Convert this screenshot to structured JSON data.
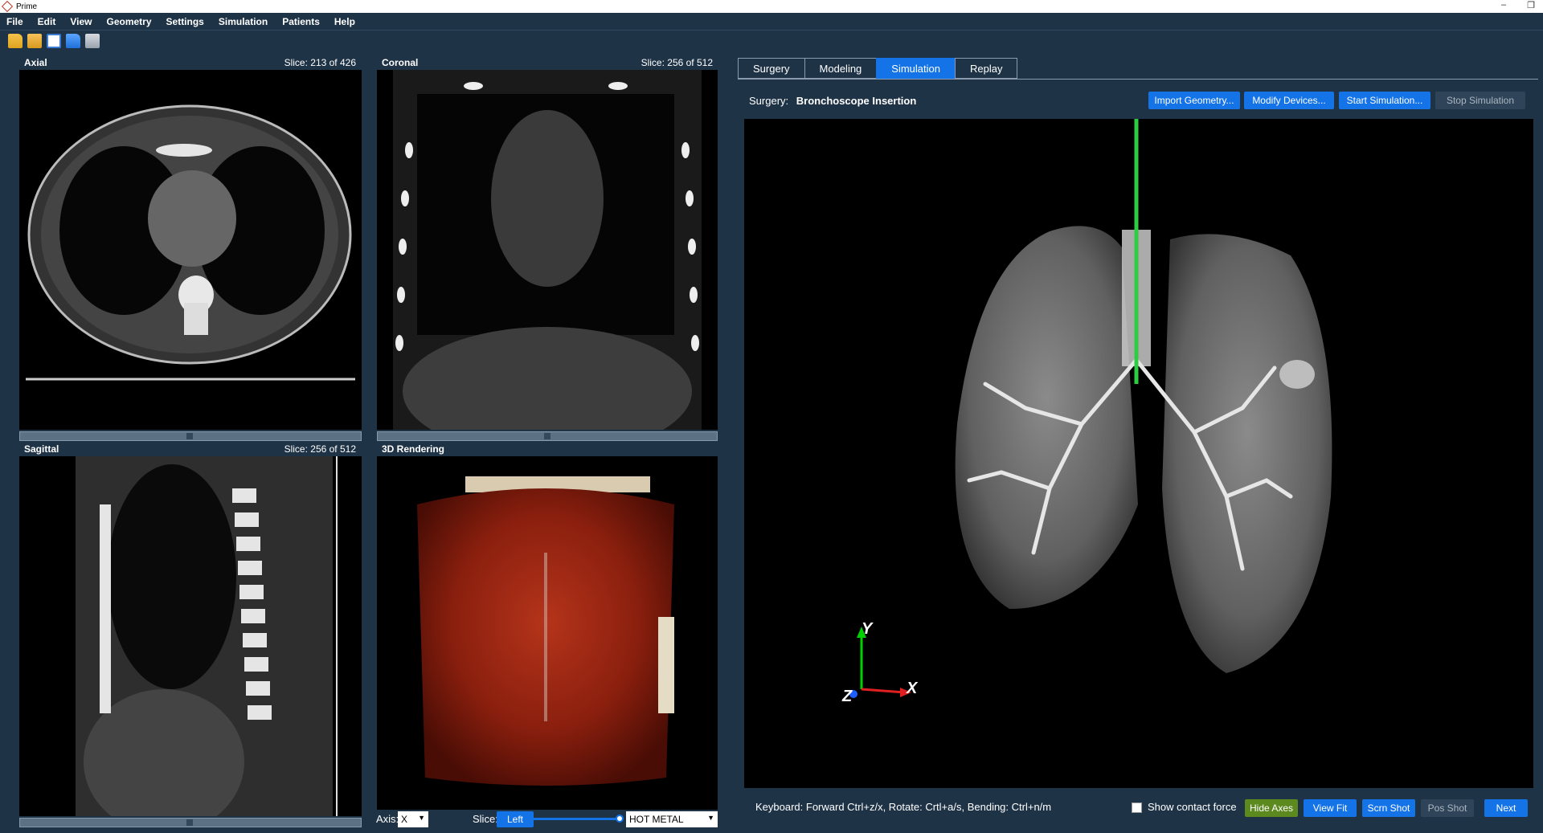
{
  "window": {
    "title": "Prime",
    "minimize": "–",
    "maximize": "❐"
  },
  "menu": [
    "File",
    "Edit",
    "View",
    "Geometry",
    "Settings",
    "Simulation",
    "Patients",
    "Help"
  ],
  "toolbar": {
    "icons": [
      "open-folder-icon",
      "open-file-icon",
      "document-icon",
      "blue-folder-icon",
      "screenshot-icon"
    ]
  },
  "panels": {
    "axial": {
      "title": "Axial",
      "slice": "Slice: 213 of 426"
    },
    "coronal": {
      "title": "Coronal",
      "slice": "Slice: 256 of 512"
    },
    "sagittal": {
      "title": "Sagittal",
      "slice": "Slice: 256 of 512"
    },
    "rendering": {
      "title": "3D Rendering"
    }
  },
  "render_controls": {
    "axis_label": "Axis:",
    "axis_value": "X",
    "slice_label": "Slice:",
    "slice_button": "Left",
    "colormap": "HOT METAL"
  },
  "tabs": [
    {
      "label": "Surgery",
      "active": false
    },
    {
      "label": "Modeling",
      "active": false
    },
    {
      "label": "Simulation",
      "active": true
    },
    {
      "label": "Replay",
      "active": false
    }
  ],
  "surgery": {
    "label": "Surgery:",
    "name": "Bronchoscope Insertion"
  },
  "actions": {
    "import": "Import Geometry...",
    "modify": "Modify Devices...",
    "start": "Start Simulation...",
    "stop": "Stop Simulation"
  },
  "axes": {
    "x": "X",
    "y": "Y",
    "z": "Z"
  },
  "footer": {
    "keyboard_hint": "Keyboard: Forward Ctrl+z/x, Rotate: Crtl+a/s, Bending: Ctrl+n/m",
    "show_contact_force": "Show contact force",
    "hide_axes": "Hide Axes",
    "view_fit": "View Fit",
    "scrn_shot": "Scrn Shot",
    "pos_shot": "Pos Shot",
    "next": "Next"
  }
}
